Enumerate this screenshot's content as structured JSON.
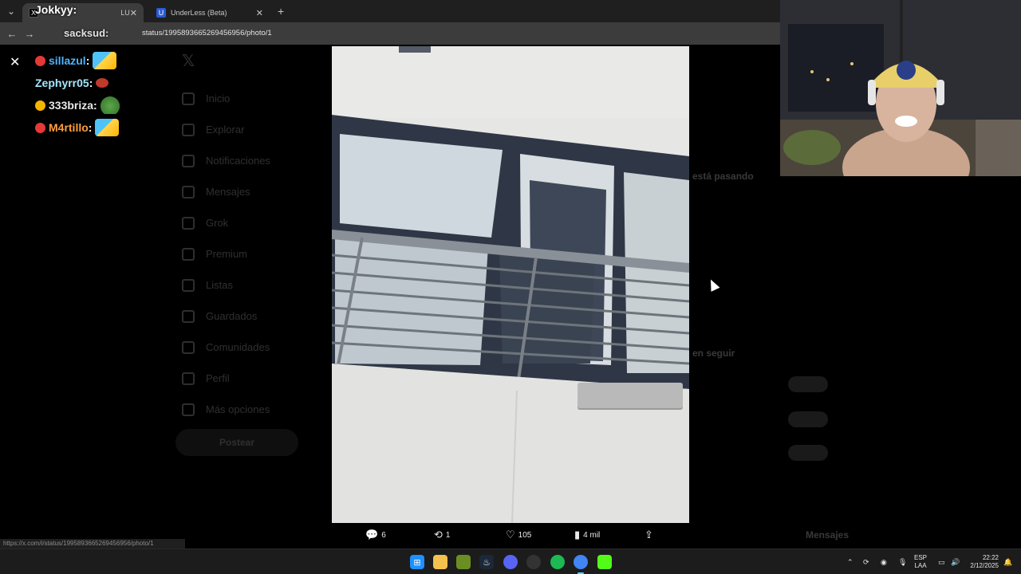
{
  "browser": {
    "tabs": [
      {
        "label": "LU",
        "favicon": "X",
        "active": true
      },
      {
        "label": "UnderLess (Beta)",
        "favicon": "U",
        "active": false
      }
    ],
    "url": "status/1995893665269456956/photo/1"
  },
  "chat": {
    "top_user": "Jokkyy",
    "top_user2": "sacksud",
    "messages": [
      {
        "user": "sillazul",
        "sep": ":",
        "color": "#4fb3ff",
        "badge": "red"
      },
      {
        "user": "Zephyrr05",
        "sep": ":",
        "color": "#a4e8ff",
        "badge": ""
      },
      {
        "user": "333briza",
        "sep": ":",
        "color": "#e8e8e8",
        "badge": "gold"
      },
      {
        "user": "M4rtillo",
        "sep": ":",
        "color": "#ff9d3b",
        "badge": "red"
      }
    ]
  },
  "x_sidebar": {
    "items": [
      "Inicio",
      "Explorar",
      "Notificaciones",
      "Mensajes",
      "Grok",
      "Premium",
      "Listas",
      "Guardados",
      "Comunidades",
      "Perfil",
      "Más opciones"
    ],
    "post_label": "Postear"
  },
  "x_right": {
    "happening": "está pasando",
    "who_to_follow": "en seguir",
    "messages": "Mensajes"
  },
  "photo_actions": {
    "replies": "6",
    "reposts": "1",
    "likes": "105",
    "views": "4 mil"
  },
  "status_url": "https://x.com/i/status/1995893665269456956/photo/1",
  "taskbar": {
    "lang_top": "ESP",
    "lang_bottom": "LAA",
    "time": "22:22",
    "date": "2/12/2025"
  }
}
